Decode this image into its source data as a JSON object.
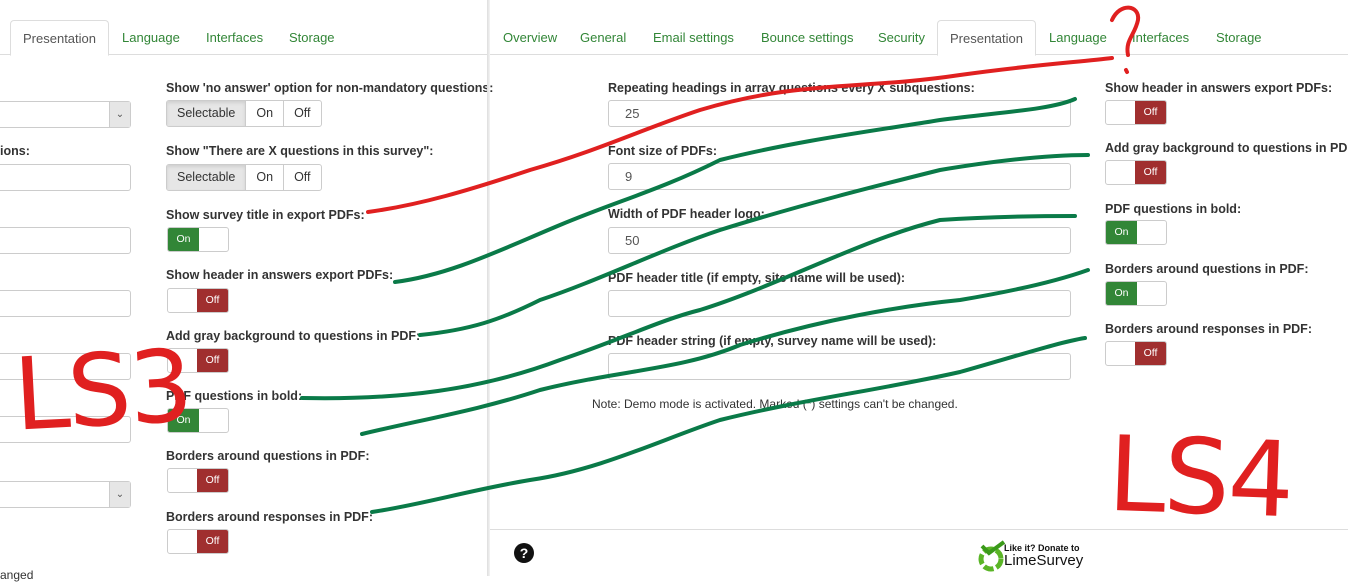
{
  "left": {
    "tabs": [
      {
        "label": "Presentation",
        "active": true
      },
      {
        "label": "Language"
      },
      {
        "label": "Interfaces"
      },
      {
        "label": "Storage"
      }
    ],
    "cut_label": "ions:",
    "settings": [
      {
        "label": "Show 'no answer' option for non-mandatory questions:",
        "type": "group",
        "options": [
          "Selectable",
          "On",
          "Off"
        ]
      },
      {
        "label": "Show \"There are X questions in this survey\":",
        "type": "group",
        "options": [
          "Selectable",
          "On",
          "Off"
        ]
      },
      {
        "label": "Show survey title in export PDFs:",
        "state": "On"
      },
      {
        "label": "Show header in answers export PDFs:",
        "state": "Off"
      },
      {
        "label": "Add gray background to questions in PDF:",
        "state": "Off"
      },
      {
        "label": "PDF questions in bold:",
        "state": "On"
      },
      {
        "label": "Borders around questions in PDF:",
        "state": "Off"
      },
      {
        "label": "Borders around responses in PDF:",
        "state": "Off"
      }
    ],
    "bottom_text": "anged"
  },
  "right": {
    "tabs": [
      {
        "label": "Overview"
      },
      {
        "label": "General"
      },
      {
        "label": "Email settings"
      },
      {
        "label": "Bounce settings"
      },
      {
        "label": "Security"
      },
      {
        "label": "Presentation",
        "active": true
      },
      {
        "label": "Language"
      },
      {
        "label": "Interfaces"
      },
      {
        "label": "Storage"
      }
    ],
    "fields": [
      {
        "label": "Repeating headings in array questions every X subquestions:",
        "value": "25"
      },
      {
        "label": "Font size of PDFs:",
        "value": "9"
      },
      {
        "label": "Width of PDF header logo:",
        "value": "50"
      },
      {
        "label": "PDF header title (if empty, site name will be used):",
        "value": ""
      },
      {
        "label": "PDF header string (if empty, survey name will be used):",
        "value": ""
      }
    ],
    "note": "Note: Demo mode is activated. Marked (*) settings can't be changed.",
    "toggles": [
      {
        "label": "Show header in answers export PDFs:",
        "state": "Off"
      },
      {
        "label": "Add gray background to questions in PDF:",
        "state": "Off"
      },
      {
        "label": "PDF questions in bold:",
        "state": "On"
      },
      {
        "label": "Borders around questions in PDF:",
        "state": "On"
      },
      {
        "label": "Borders around responses in PDF:",
        "state": "Off"
      }
    ],
    "footer": {
      "help": "?",
      "donate_small": "Like it? Donate to",
      "donate_brand": "LimeSurvey"
    }
  },
  "annotations": [
    "LS3",
    "LS4",
    "?"
  ],
  "colors": {
    "accent": "#328637",
    "off": "#a02f2f",
    "ink_red": "#e02020",
    "ink_green": "#0a7a48"
  }
}
